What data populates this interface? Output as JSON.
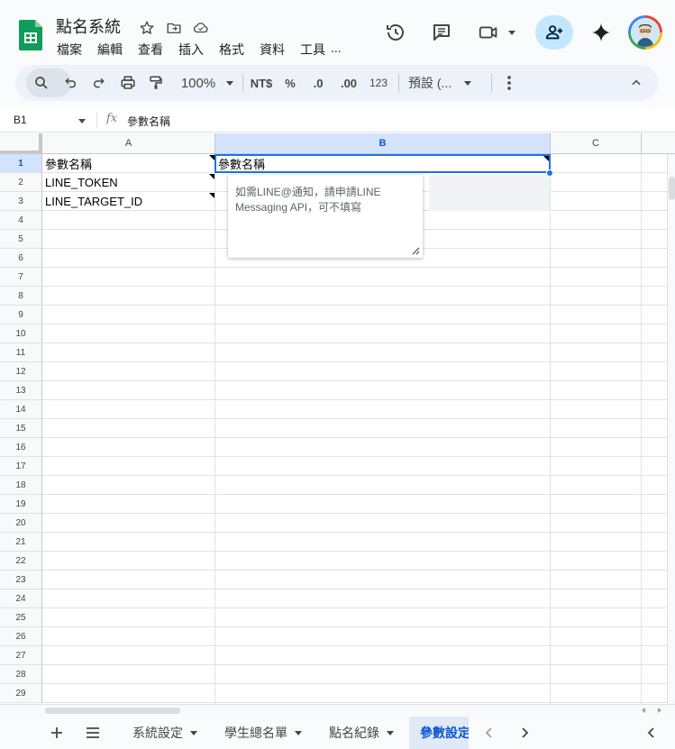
{
  "app": {
    "title": "點名系統",
    "menu": [
      "檔案",
      "編輯",
      "查看",
      "插入",
      "格式",
      "資料",
      "工具",
      "..."
    ]
  },
  "toolbar": {
    "zoom": "100%",
    "currency": "NT$",
    "percent": "%",
    "dec_decrease": ".0",
    "dec_increase": ".00",
    "number_format": "123",
    "font": "預設 (..."
  },
  "formula_bar": {
    "name_box": "B1",
    "fx": "fx",
    "content": "參數名稱"
  },
  "grid": {
    "columns": [
      "A",
      "B",
      "C"
    ],
    "selected_column": "B",
    "rows": [
      "1",
      "2",
      "3",
      "4",
      "5",
      "6",
      "7",
      "8",
      "9",
      "10",
      "11",
      "12",
      "13",
      "14",
      "15",
      "16",
      "17",
      "18",
      "19",
      "20",
      "21",
      "22",
      "23",
      "24",
      "25",
      "26",
      "27",
      "28",
      "29"
    ],
    "selected_row": "1",
    "cells": {
      "a1": "參數名稱",
      "a2": "LINE_TOKEN",
      "a3": "LINE_TARGET_ID",
      "b1": "參數名稱"
    }
  },
  "note": {
    "text": "如需LINE@通知，請申請LINE Messaging API，可不填寫"
  },
  "sheet_tabs": [
    {
      "label": "系統設定"
    },
    {
      "label": "學生總名單"
    },
    {
      "label": "點名紀錄"
    },
    {
      "label": "參數設定"
    }
  ],
  "colors": {
    "accent": "#0b57d0",
    "selection": "#1a73e8",
    "sheets_green": "#0f9d58"
  }
}
